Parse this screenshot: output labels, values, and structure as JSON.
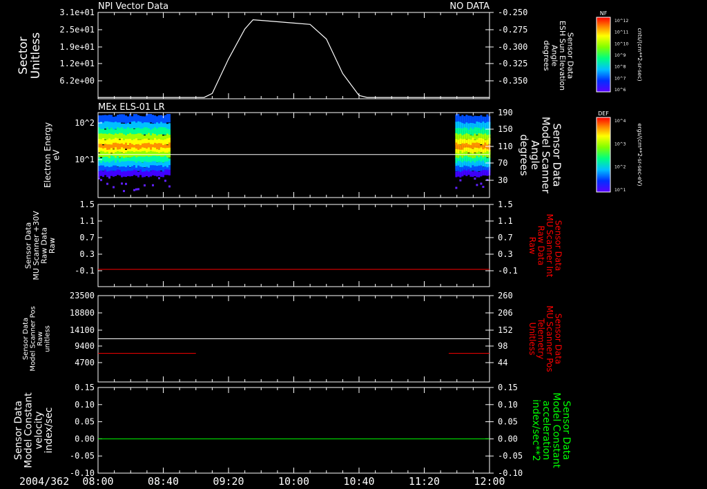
{
  "header": {
    "left_title": "NPI Vector Data",
    "right_title": "NO DATA"
  },
  "chart_data": [
    {
      "type": "line",
      "title": "NPI Vector Data",
      "status": "NO DATA",
      "left_axis": {
        "label_lines": [
          "Sector",
          "Unitless"
        ],
        "ticks": [
          "3.1e+01",
          "2.5e+01",
          "1.9e+01",
          "1.2e+01",
          "6.2e+00"
        ]
      },
      "right_axis": {
        "label_lines": [
          "Sensor Data",
          "ESH Sun Elevation",
          "Angle",
          "degrees"
        ],
        "ticks": [
          "-0.250",
          "-0.275",
          "-0.300",
          "-0.325",
          "-0.350"
        ],
        "ylim": [
          -0.38,
          -0.25
        ]
      },
      "series": [
        {
          "name": "",
          "color": "#ffffff",
          "x": [
            "08:00",
            "09:05",
            "09:10",
            "09:20",
            "09:30",
            "09:35",
            "09:45",
            "10:00",
            "10:10",
            "10:20",
            "10:30",
            "10:40",
            "10:45",
            "11:00",
            "12:00"
          ],
          "y": [
            -0.378,
            -0.378,
            -0.372,
            -0.32,
            -0.275,
            -0.261,
            -0.263,
            -0.266,
            -0.268,
            -0.29,
            -0.342,
            -0.375,
            -0.378,
            -0.378,
            -0.378
          ]
        }
      ]
    },
    {
      "type": "heatmap",
      "title": "MEx ELS-01 LR",
      "left_axis": {
        "label_lines": [
          "Electron Energy",
          "eV"
        ],
        "ticks": [
          "10^2",
          "10^1"
        ]
      },
      "right_axis": {
        "label_lines": [
          "Sensor Data",
          "Model Scanner",
          "Angle",
          "degrees"
        ],
        "ticks": [
          "190",
          "150",
          "110",
          "70",
          "30"
        ]
      },
      "data_intervals": [
        [
          "08:00",
          "08:44"
        ],
        [
          "11:39",
          "12:00"
        ]
      ],
      "overlay_line": {
        "axis": "right",
        "value": 90,
        "color": "#ffffff"
      },
      "colorbar": {
        "label": "DEF",
        "unit": "ergs/(cm**2-sr-sec-eV)",
        "ticks": [
          "10^4",
          "10^3",
          "10^2",
          "10^1"
        ]
      }
    },
    {
      "type": "line",
      "left_axis": {
        "label_lines": [
          "Sensor Data",
          "MU Scanner +30V",
          "Raw Data",
          "Raw"
        ],
        "ticks": [
          "1.5",
          "1.1",
          "0.7",
          "0.3",
          "-0.1"
        ],
        "ylim": [
          -0.4,
          1.5
        ]
      },
      "right_axis": {
        "label_lines": [
          "Sensor Data",
          "MU Scanner Int",
          "Raw Data",
          "Raw"
        ],
        "ticks": [
          "1.5",
          "1.1",
          "0.7",
          "0.3",
          "-0.1"
        ],
        "color": "#ff0000"
      },
      "series": [
        {
          "name": "",
          "color": "#ff0000",
          "x": [
            "08:00",
            "12:00"
          ],
          "y": [
            0,
            0
          ]
        }
      ]
    },
    {
      "type": "line",
      "left_axis": {
        "label_lines": [
          "Sensor Data",
          "Model Scanner Pos",
          "Raw",
          "unitless"
        ],
        "ticks": [
          "23500",
          "18800",
          "14100",
          "9400",
          "4700"
        ],
        "ylim": [
          0,
          23500
        ]
      },
      "right_axis": {
        "label_lines": [
          "Sensor Data",
          "MU Scanner Pos",
          "Telemetry",
          "Unitless"
        ],
        "ticks": [
          "260",
          "206",
          "152",
          "98",
          "44"
        ],
        "ylim": [
          0,
          260
        ],
        "color": "#ff0000"
      },
      "series": [
        {
          "name": "",
          "color": "#ffffff",
          "axis": "left",
          "x": [
            "08:00",
            "12:00"
          ],
          "y": [
            11750,
            11750
          ]
        },
        {
          "name": "",
          "color": "#ff0000",
          "axis": "right",
          "x": [
            "08:00",
            "09:00"
          ],
          "y": [
            86,
            86
          ]
        },
        {
          "name": "",
          "color": "#ff0000",
          "axis": "right",
          "x": [
            "11:35",
            "12:00"
          ],
          "y": [
            86,
            86
          ]
        }
      ]
    },
    {
      "type": "line",
      "left_axis": {
        "label_lines": [
          "Sensor Data",
          "Model Constant",
          "velocity",
          "index/sec"
        ],
        "ticks": [
          "0.15",
          "0.10",
          "0.05",
          "0.00",
          "-0.05",
          "-0.10"
        ],
        "ylim": [
          -0.1,
          0.15
        ]
      },
      "right_axis": {
        "label_lines": [
          "Sensor Data",
          "Model Constant",
          "acceleration",
          "index/sec**2"
        ],
        "ticks": [
          "0.15",
          "0.10",
          "0.05",
          "0.00",
          "-0.05",
          "-0.10"
        ],
        "color": "#00ff00"
      },
      "series": [
        {
          "name": "",
          "color": "#00ff00",
          "x": [
            "08:00",
            "12:00"
          ],
          "y": [
            0,
            0
          ]
        }
      ]
    }
  ],
  "x_axis": {
    "date_label": "2004/362",
    "ticks": [
      "08:00",
      "08:40",
      "09:20",
      "10:00",
      "10:40",
      "11:20",
      "12:00"
    ]
  },
  "colorbar_top": {
    "label": "NF",
    "unit": "cnts/(cm**2-sr-sec)",
    "ticks": [
      "10^12",
      "10^11",
      "10^10",
      "10^9",
      "10^8",
      "10^7",
      "10^6"
    ]
  }
}
